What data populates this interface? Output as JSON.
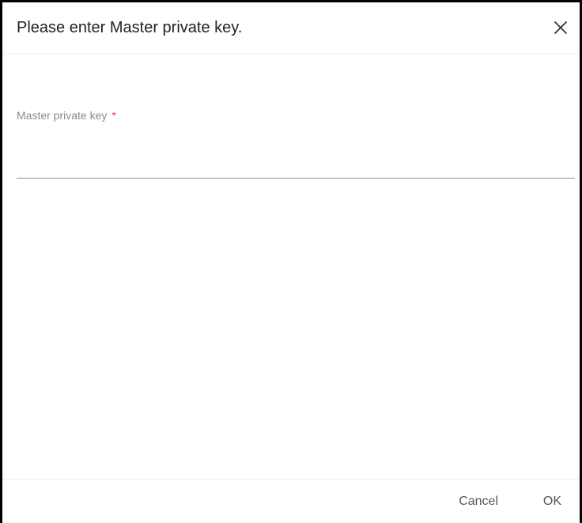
{
  "dialog": {
    "title": "Please enter Master private key.",
    "close_icon": "close-icon"
  },
  "form": {
    "master_key": {
      "label": "Master private key",
      "required_marker": "*",
      "value": ""
    }
  },
  "footer": {
    "cancel_label": "Cancel",
    "ok_label": "OK"
  },
  "colors": {
    "required": "#e53935",
    "label": "#8a8a8a",
    "underline": "#8f8f8f"
  }
}
